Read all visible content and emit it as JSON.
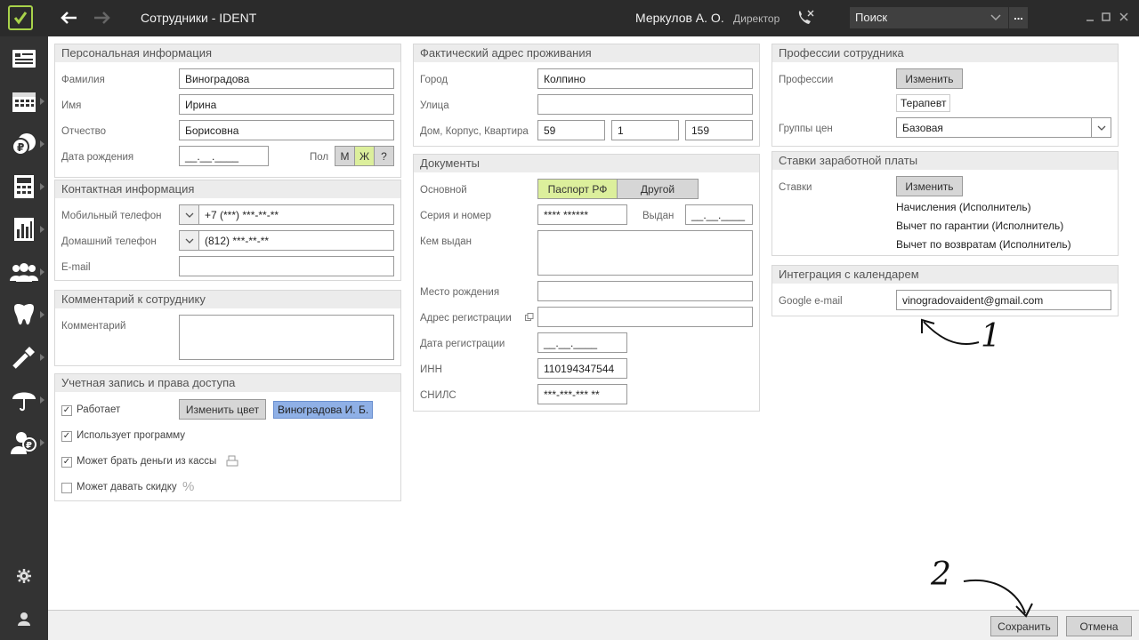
{
  "window": {
    "title": "Сотрудники - IDENT",
    "user_name": "Меркулов А. О.",
    "user_role": "Директор",
    "search_placeholder": "Поиск",
    "search_more": "..."
  },
  "sidebar": {
    "items": [
      {
        "icon": "contact-card-icon"
      },
      {
        "icon": "calendar-icon"
      },
      {
        "icon": "cash-register-icon"
      },
      {
        "icon": "calculator-icon"
      },
      {
        "icon": "reports-chart-icon"
      },
      {
        "icon": "staff-group-icon"
      },
      {
        "icon": "tooth-icon"
      },
      {
        "icon": "tools-icon"
      },
      {
        "icon": "umbrella-insurance-icon"
      },
      {
        "icon": "client-money-icon"
      }
    ],
    "bottom": [
      {
        "icon": "gear-icon"
      },
      {
        "icon": "user-icon"
      }
    ]
  },
  "personal": {
    "header": "Персональная информация",
    "surname_label": "Фамилия",
    "surname": "Виноградова",
    "name_label": "Имя",
    "name": "Ирина",
    "patronymic_label": "Отчество",
    "patronymic": "Борисовна",
    "birthdate_label": "Дата рождения",
    "birthdate": "__.__.____",
    "gender_label": "Пол",
    "gender_m": "М",
    "gender_f": "Ж",
    "gender_unknown": "?"
  },
  "contacts": {
    "header": "Контактная информация",
    "mobile_label": "Мобильный телефон",
    "mobile": "+7 (***) ***-**-**",
    "home_label": "Домашний телефон",
    "home": "(812) ***-**-**",
    "email_label": "E-mail",
    "email": ""
  },
  "comment": {
    "header": "Комментарий к сотруднику",
    "label": "Комментарий",
    "value": ""
  },
  "account": {
    "header": "Учетная запись и права доступа",
    "works_label": "Работает",
    "works": true,
    "change_color": "Изменить цвет",
    "color_tag": "Виноградова И. Б.",
    "uses_program_label": "Использует программу",
    "uses_program": true,
    "cash_label": "Может брать деньги из кассы",
    "cash": true,
    "discount_label": "Может давать скидку",
    "discount": false
  },
  "address": {
    "header": "Фактический адрес проживания",
    "city_label": "Город",
    "city": "Колпино",
    "street_label": "Улица",
    "street": "",
    "house_label": "Дом, Корпус, Квартира",
    "house": "59",
    "building": "1",
    "flat": "159"
  },
  "documents": {
    "header": "Документы",
    "main_label": "Основной",
    "doc_passport": "Паспорт РФ",
    "doc_other": "Другой",
    "series_label": "Серия и номер",
    "series": "**** ******",
    "issued_label": "Выдан",
    "issued": "__.__.____",
    "issued_by_label": "Кем выдан",
    "issued_by": "",
    "birthplace_label": "Место рождения",
    "birthplace": "",
    "reg_address_label": "Адрес регистрации",
    "reg_address": "",
    "reg_date_label": "Дата регистрации",
    "reg_date": "__.__.____",
    "inn_label": "ИНН",
    "inn": "110194347544",
    "snils_label": "СНИЛС",
    "snils": "***-***-*** **"
  },
  "professions": {
    "header": "Профессии сотрудника",
    "label": "Профессии",
    "change": "Изменить",
    "tag": "Терапевт",
    "price_group_label": "Группы цен",
    "price_group": "Базовая"
  },
  "salary": {
    "header": "Ставки заработной платы",
    "label": "Ставки",
    "change": "Изменить",
    "items": [
      "Начисления (Исполнитель)",
      "Вычет по гарантии (Исполнитель)",
      "Вычет по возвратам (Исполнитель)"
    ]
  },
  "calendar": {
    "header": "Интеграция с календарем",
    "google_label": "Google e-mail",
    "google_email": "vinogradovaident@gmail.com"
  },
  "footer": {
    "save": "Сохранить",
    "cancel": "Отмена"
  },
  "annotations": {
    "one": "1",
    "two": "2"
  },
  "colors": {
    "accent_green": "#a8d24a",
    "selected_green": "#dcef9c",
    "tag_blue": "#8fb0e6"
  }
}
